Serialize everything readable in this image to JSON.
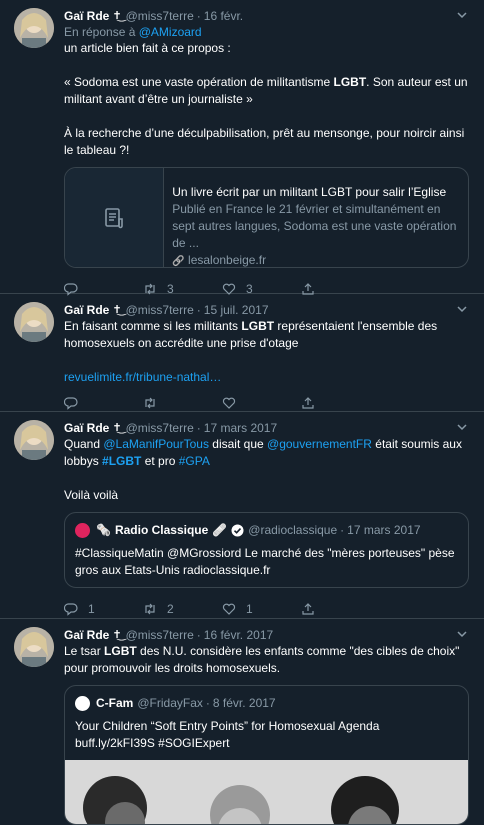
{
  "tweets": [
    {
      "name": "Gaï Rde",
      "deco": "✝͜",
      "handle": "@miss7terre",
      "date": "16 févr.",
      "reply_prefix": "En réponse à",
      "reply_to": "@AMizoard",
      "text_intro": "un article bien fait à ce propos :",
      "quote_open": "« Sodoma est une vaste opération de militantisme",
      "quote_bold": "LGBT",
      "quote_rest": ". Son auteur est un militant avant d’être un journaliste »",
      "text_last": "À la recherche d’une déculpabilisation, prêt au mensonge, pour noircir ainsi le tableau ?!",
      "card": {
        "title": "Un livre écrit par un militant LGBT pour salir l’Eglise",
        "desc": "Publié en France le 21 février et simultanément en sept autres langues, Sodoma est une vaste opération de ...",
        "domain": "lesalonbeige.fr",
        "icon": "document-icon"
      },
      "counts": {
        "reply": "",
        "retweet": "3",
        "like": "3"
      }
    },
    {
      "name": "Gaï Rde",
      "deco": "✝͜",
      "handle": "@miss7terre",
      "date": "15 juil. 2017",
      "t_a": "En faisant comme si les militants",
      "t_bold": "LGBT",
      "t_b": "représentaient l'ensemble des homosexuels on accrédite une prise d'otage",
      "link": "revuelimite.fr/tribune-nathal…",
      "counts": {
        "reply": "",
        "retweet": "",
        "like": ""
      }
    },
    {
      "name": "Gaï Rde",
      "deco": "✝͜",
      "handle": "@miss7terre",
      "date": "17 mars 2017",
      "t_quand": "Quand",
      "m1": "@LaManifPourTous",
      "t_dit": "disait que",
      "m2": "@gouvernementFR",
      "t_etait": "était soumis aux lobbys",
      "h1": "#LGBT",
      "t_et": "et pro",
      "h2": "#GPA",
      "t_voila": "Voilà voilà",
      "quote": {
        "name": "Radio Classique",
        "emoji": "🗞️",
        "emoji2": "🩹",
        "handle": "@radioclassique",
        "date": "17 mars 2017",
        "text": "#ClassiqueMatin @MGrossiord Le marché des \"mères porteuses\" pèse gros aux Etats-Unis radioclassique.fr",
        "logo_color": "#e0245e"
      },
      "counts": {
        "reply": "1",
        "retweet": "2",
        "like": "1"
      }
    },
    {
      "name": "Gaï Rde",
      "deco": "✝͜",
      "handle": "@miss7terre",
      "date": "16 févr. 2017",
      "t_a": "Le tsar",
      "t_bold": "LGBT",
      "t_b": "des N.U. considère les enfants comme \"des cibles de choix\" pour promouvoir les droits homosexuels.",
      "quote": {
        "name": "C-Fam",
        "handle": "@FridayFax",
        "date": "8 févr. 2017",
        "text": "Your Children “Soft Entry Points” for Homosexual Agenda buff.ly/2kFI39S #SOGIExpert",
        "logo_color": "#ffffff"
      }
    }
  ],
  "ui": {
    "dot": "·",
    "chevron": "chevron-down-icon",
    "link_icon": "🔗"
  }
}
